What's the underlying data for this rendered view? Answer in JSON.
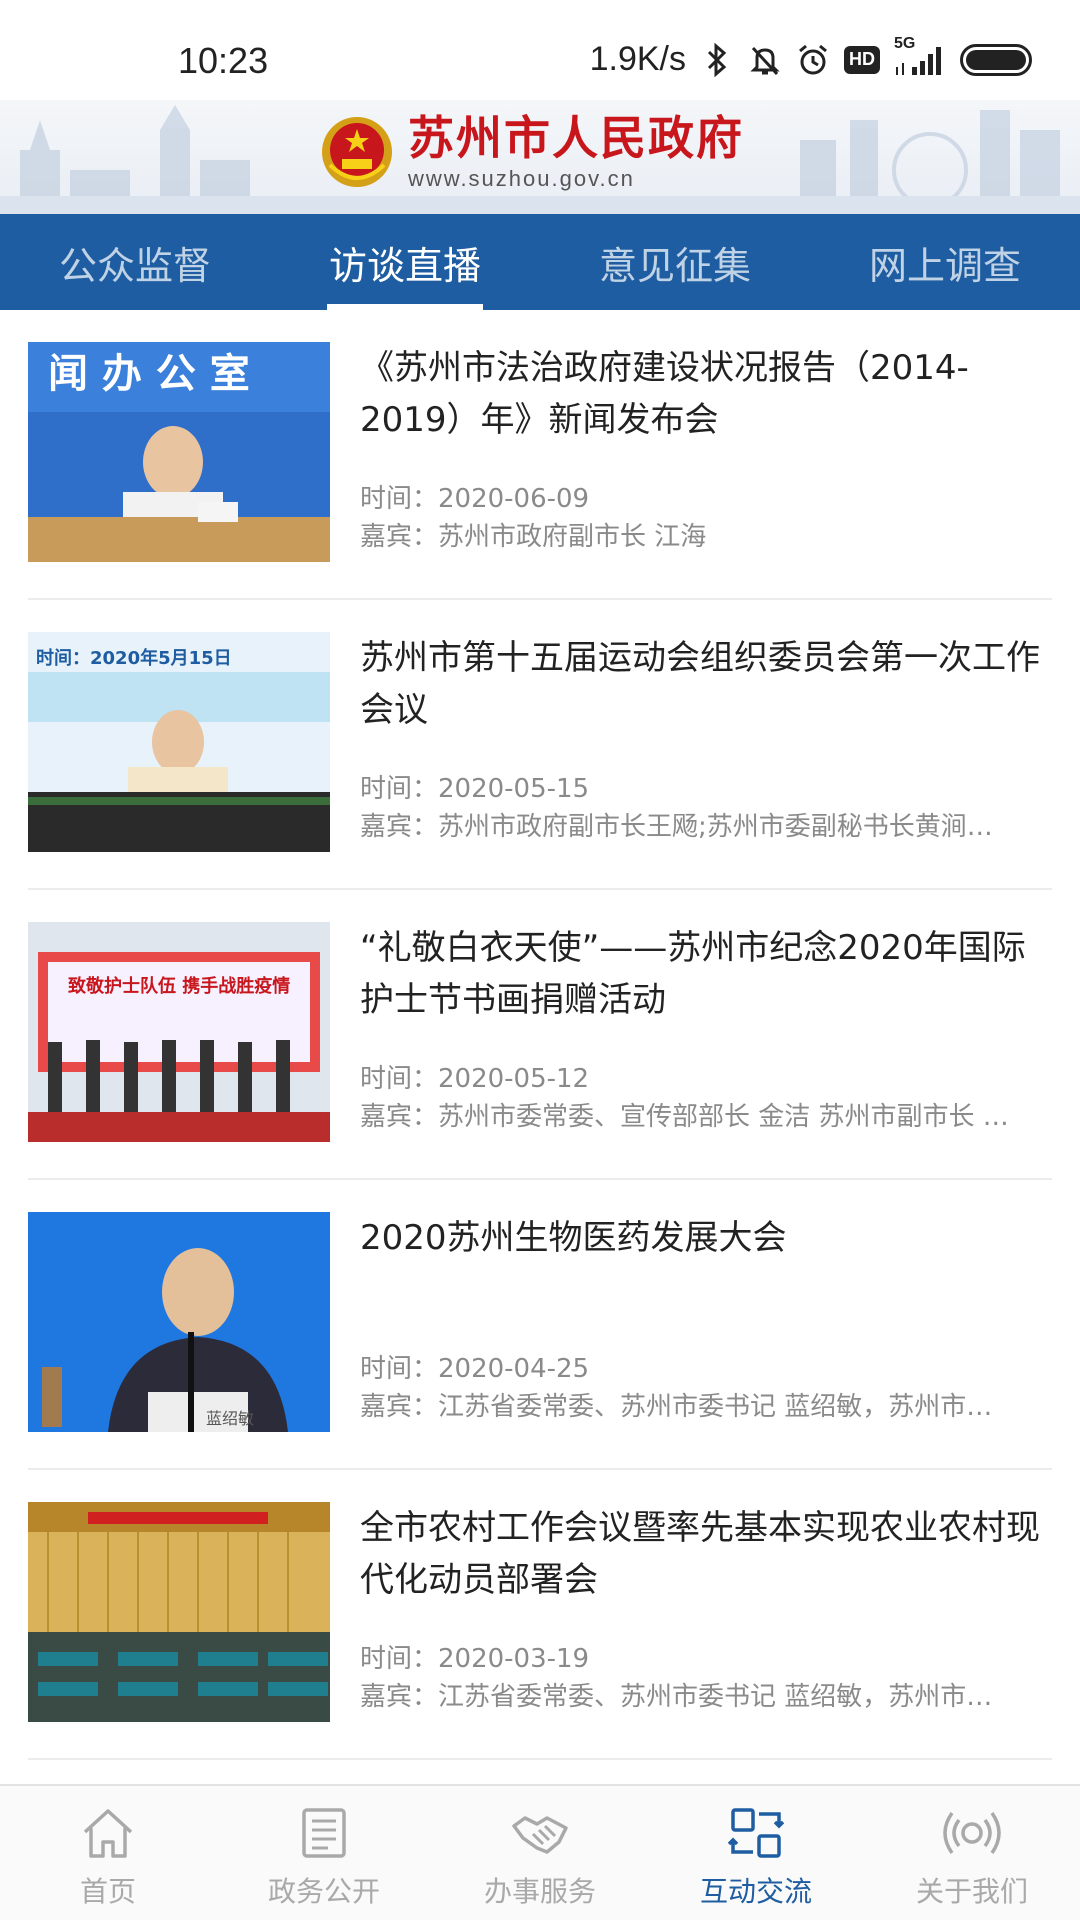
{
  "status_bar": {
    "time": "10:23",
    "speed": "1.9K/s",
    "hd_label": "HD",
    "network_label": "5G",
    "icons": [
      "bluetooth-icon",
      "mute-bell-icon",
      "alarm-icon",
      "hd-icon",
      "signal-icon",
      "battery-icon"
    ]
  },
  "header": {
    "title": "苏州市人民政府",
    "url": "www.suzhou.gov.cn",
    "brand_color": "#c8161d"
  },
  "tabs": [
    {
      "label": "公众监督",
      "active": false
    },
    {
      "label": "访谈直播",
      "active": true
    },
    {
      "label": "意见征集",
      "active": false
    },
    {
      "label": "网上调查",
      "active": false
    }
  ],
  "accent_color": "#1e5da1",
  "items": [
    {
      "title": "《苏州市法治政府建设状况报告（2014-2019）年》新闻发布会",
      "time": "时间：2020-06-09",
      "guest": "嘉宾：苏州市政府副市长 江海",
      "thumb_text": "闻 办 公 室"
    },
    {
      "title": "苏州市第十五届运动会组织委员会第一次工作会议",
      "time": "时间：2020-05-15",
      "guest": "嘉宾：苏州市政府副市长王飏;苏州市委副秘书长黄涧…",
      "thumb_text": "时间：2020年5月15日"
    },
    {
      "title": "“礼敬白衣天使”——苏州市纪念2020年国际护士节书画捐赠活动",
      "time": "时间：2020-05-12",
      "guest": "嘉宾：苏州市委常委、宣传部部长 金洁 苏州市副市长 …",
      "thumb_text": "致敬护士队伍 携手战胜疫情"
    },
    {
      "title": "2020苏州生物医药发展大会",
      "time": "时间：2020-04-25",
      "guest": "嘉宾：江苏省委常委、苏州市委书记 蓝绍敏，苏州市…",
      "thumb_text": "蓝绍敏"
    },
    {
      "title": "全市农村工作会议暨率先基本实现农业农村现代化动员部署会",
      "time": "时间：2020-03-19",
      "guest": "嘉宾：江苏省委常委、苏州市委书记 蓝绍敏，苏州市…",
      "thumb_text": ""
    }
  ],
  "bottom_nav": [
    {
      "label": "首页",
      "icon": "home-icon",
      "active": false
    },
    {
      "label": "政务公开",
      "icon": "document-list-icon",
      "active": false
    },
    {
      "label": "办事服务",
      "icon": "handshake-icon",
      "active": false
    },
    {
      "label": "互动交流",
      "icon": "interaction-icon",
      "active": true
    },
    {
      "label": "关于我们",
      "icon": "broadcast-icon",
      "active": false
    }
  ]
}
